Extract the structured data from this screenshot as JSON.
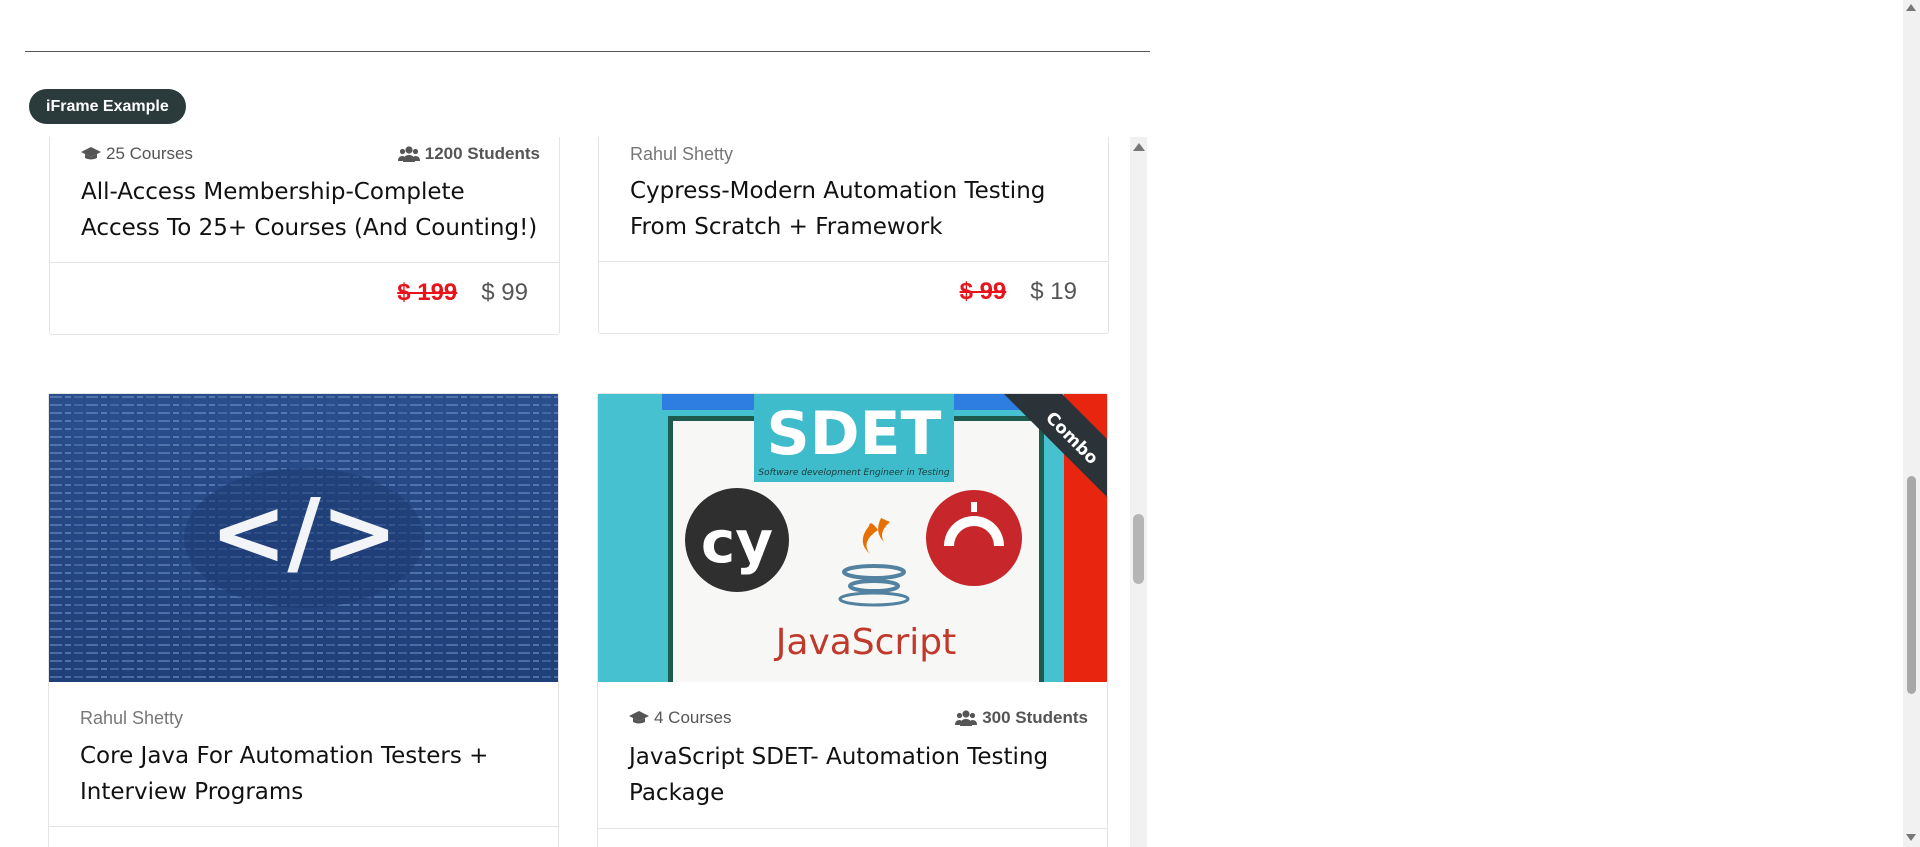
{
  "badge": {
    "label": "iFrame Example"
  },
  "courses": [
    {
      "courses_count": "25 Courses",
      "students": "1200 Students",
      "title_line1": "All-Access Membership-Complete",
      "title_line2": "Access To 25+ Courses (And Counting!)",
      "old_price": "$ 199",
      "new_price": "$ 99"
    },
    {
      "author": "Rahul Shetty",
      "title_line1": "Cypress-Modern Automation Testing",
      "title_line2": "From Scratch + Framework",
      "old_price": "$ 99",
      "new_price": "$ 19"
    },
    {
      "author": "Rahul Shetty",
      "title_line1": "Core Java For Automation Testers +",
      "title_line2": "Interview Programs",
      "image_label": "</>"
    },
    {
      "courses_count": "4 Courses",
      "students": "300 Students",
      "title_line1": "JavaScript SDET- Automation Testing",
      "title_line2": "Package",
      "image": {
        "sdet": "SDET",
        "sdet_sub": "Software development Engineer in Testing",
        "cy": "cy",
        "js": "JavaScript",
        "ribbon": "Combo"
      }
    }
  ],
  "colors": {
    "strike_price": "#e8141b",
    "badge_bg": "#2b3a3a",
    "sdet_teal": "#3fbccb",
    "ribbon": "#2c3338"
  }
}
